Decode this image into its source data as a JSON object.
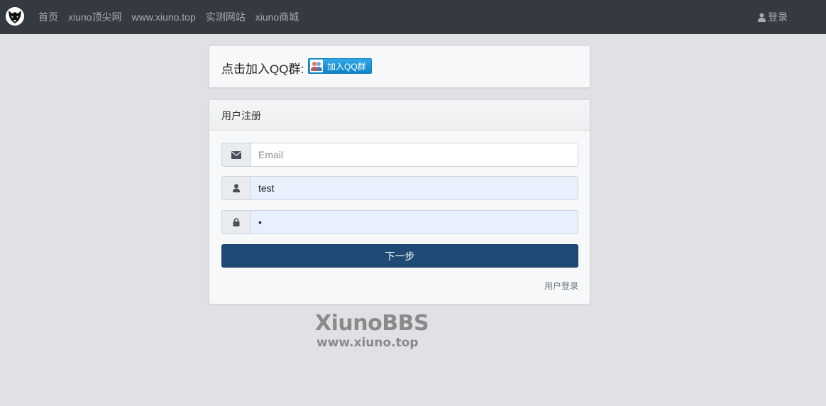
{
  "nav": {
    "logo_icon": "wolf-logo-icon",
    "links": [
      {
        "label": "首页"
      },
      {
        "label": "xiuno顶尖网"
      },
      {
        "label": "www.xiuno.top"
      },
      {
        "label": "实测网站"
      },
      {
        "label": "xiuno商城"
      }
    ],
    "login_label": "登录",
    "login_icon": "user-icon"
  },
  "qq": {
    "text": "点击加入QQ群:",
    "button_label": "加入QQ群",
    "button_icon": "qq-group-icon"
  },
  "register": {
    "title": "用户注册",
    "email": {
      "icon": "envelope-icon",
      "placeholder": "Email",
      "value": ""
    },
    "username": {
      "icon": "user-icon",
      "value": "test"
    },
    "password": {
      "icon": "lock-icon",
      "value": "1"
    },
    "submit_label": "下一步",
    "login_link": "用户登录"
  },
  "watermark": {
    "title": "XiunoBBS",
    "url": "www.xiuno.top"
  },
  "colors": {
    "navbar": "#343a40",
    "page_bg": "#dfe1e5",
    "primary_button": "#1f4a75",
    "autofill_bg": "#e8f0fe"
  }
}
